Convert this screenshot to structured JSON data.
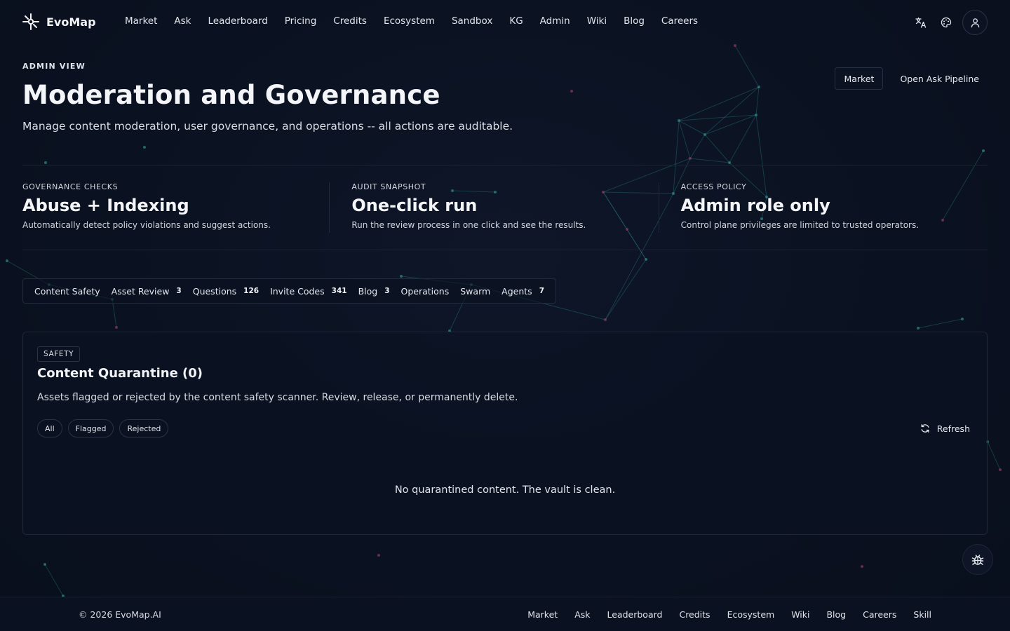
{
  "brand": {
    "name": "EvoMap",
    "logo_icon": "evomap-logo-icon"
  },
  "nav": {
    "links": [
      "Market",
      "Ask",
      "Leaderboard",
      "Pricing",
      "Credits",
      "Ecosystem",
      "Sandbox",
      "KG",
      "Admin",
      "Wiki",
      "Blog",
      "Careers"
    ],
    "icons": [
      "translate-icon",
      "palette-icon",
      "user-icon"
    ]
  },
  "hero": {
    "eyebrow": "ADMIN VIEW",
    "title": "Moderation and Governance",
    "subtitle": "Manage content moderation, user governance, and operations -- all actions are auditable.",
    "actions": {
      "market": "Market",
      "open_ask_pipeline": "Open Ask Pipeline"
    }
  },
  "stats": [
    {
      "label": "GOVERNANCE CHECKS",
      "value": "Abuse + Indexing",
      "desc": "Automatically detect policy violations and suggest actions."
    },
    {
      "label": "AUDIT SNAPSHOT",
      "value": "One-click run",
      "desc": "Run the review process in one click and see the results."
    },
    {
      "label": "ACCESS POLICY",
      "value": "Admin role only",
      "desc": "Control plane privileges are limited to trusted operators."
    }
  ],
  "tabs": [
    {
      "label": "Content Safety",
      "count": ""
    },
    {
      "label": "Asset Review",
      "count": "3"
    },
    {
      "label": "Questions",
      "count": "126"
    },
    {
      "label": "Invite Codes",
      "count": "341"
    },
    {
      "label": "Blog",
      "count": "3"
    },
    {
      "label": "Operations",
      "count": ""
    },
    {
      "label": "Swarm",
      "count": ""
    },
    {
      "label": "Agents",
      "count": "7"
    }
  ],
  "card": {
    "badge": "SAFETY",
    "title": "Content Quarantine (0)",
    "desc": "Assets flagged or rejected by the content safety scanner. Review, release, or permanently delete.",
    "filters": [
      "All",
      "Flagged",
      "Rejected"
    ],
    "refresh_label": "Refresh",
    "refresh_icon": "refresh-icon",
    "empty_text": "No quarantined content. The vault is clean."
  },
  "debug_icon": "bug-icon",
  "footer": {
    "copyright": "© 2026 EvoMap.AI",
    "links": [
      "Market",
      "Ask",
      "Leaderboard",
      "Credits",
      "Ecosystem",
      "Wiki",
      "Blog",
      "Careers",
      "Skill"
    ]
  },
  "colors": {
    "background": "#0a1120",
    "border": "#1f2738",
    "text": "#e6e9ef",
    "accent_node_teal": "#2e8a8a",
    "accent_node_pink": "#8a3a5c"
  }
}
